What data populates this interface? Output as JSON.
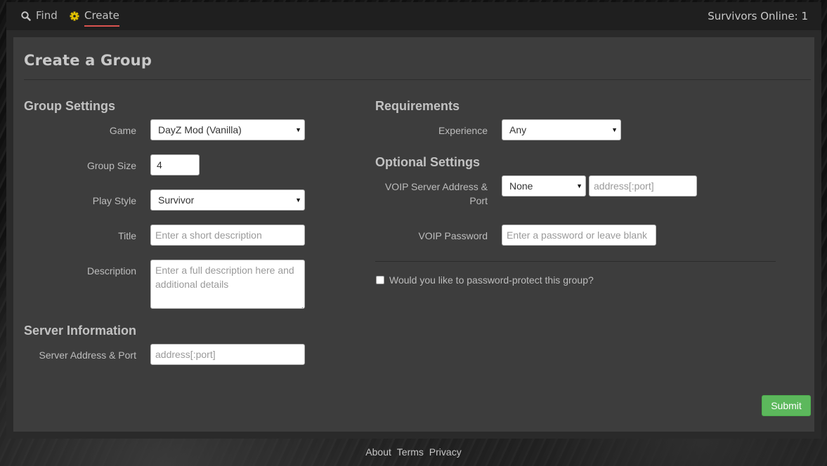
{
  "nav": {
    "find_label": "Find",
    "create_label": "Create",
    "online_text": "Survivors Online: 1",
    "accent_color": "#d9534f",
    "gear_color": "#e0c000"
  },
  "page": {
    "title": "Create a Group"
  },
  "group_settings": {
    "heading": "Group Settings",
    "game_label": "Game",
    "game_value": "DayZ Mod (Vanilla)",
    "size_label": "Group Size",
    "size_value": "4",
    "style_label": "Play Style",
    "style_value": "Survivor",
    "title_label": "Title",
    "title_placeholder": "Enter a short description",
    "desc_label": "Description",
    "desc_placeholder": "Enter a full description here and additional details"
  },
  "server_info": {
    "heading": "Server Information",
    "address_label": "Server Address & Port",
    "address_placeholder": "address[:port]"
  },
  "requirements": {
    "heading": "Requirements",
    "experience_label": "Experience",
    "experience_value": "Any"
  },
  "optional": {
    "heading": "Optional Settings",
    "voip_label": "VOIP Server Address & Port",
    "voip_type_value": "None",
    "voip_address_placeholder": "address[:port]",
    "voip_password_label": "VOIP Password",
    "voip_password_placeholder": "Enter a password or leave blank",
    "protect_label": "Would you like to password-protect this group?",
    "protect_checked": false
  },
  "actions": {
    "submit_label": "Submit",
    "submit_color": "#5cb85c"
  },
  "footer": {
    "about": "About",
    "terms": "Terms",
    "privacy": "Privacy"
  }
}
